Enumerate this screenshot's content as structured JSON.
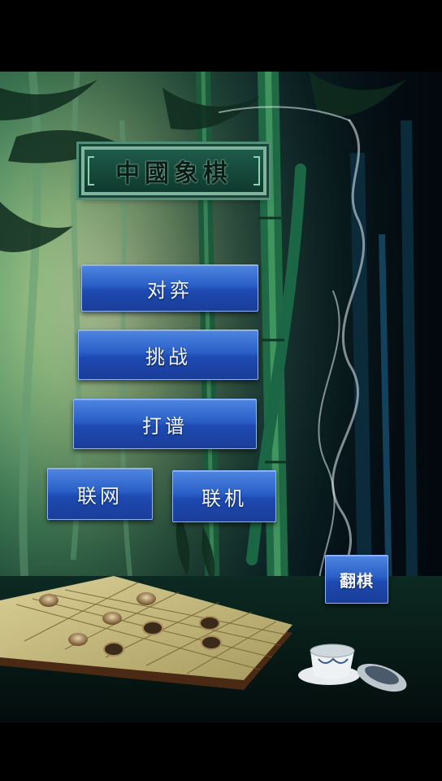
{
  "title": "中國象棋",
  "menu": {
    "duiyi": "对弈",
    "tiaozhan": "挑战",
    "dapu": "打谱",
    "lianwang": "联网",
    "lianji": "联机",
    "fanqi": "翻棋"
  },
  "colors": {
    "button_blue": "#2a5fc7",
    "plaque_green": "#1e5a4a",
    "background": "#000000"
  }
}
